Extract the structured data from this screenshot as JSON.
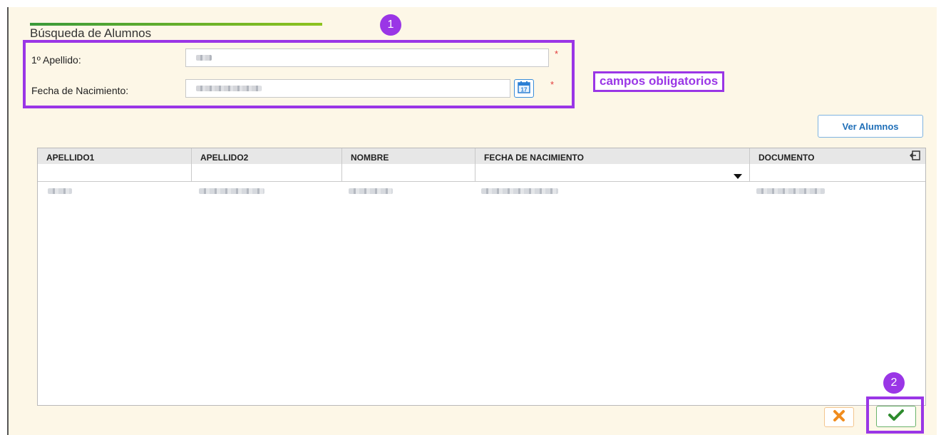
{
  "form": {
    "title": "Búsqueda de Alumnos",
    "apellido_label": "1º Apellido:",
    "fecha_label": "Fecha de Nacimiento:",
    "required_mark": "*"
  },
  "annotations": {
    "badge_1": "1",
    "badge_2": "2",
    "required_note": "campos obligatorios",
    "highlight_color": "#9a36e6"
  },
  "buttons": {
    "ver_alumnos": "Ver Alumnos"
  },
  "grid": {
    "columns": [
      "APELLIDO1",
      "APELLIDO2",
      "NOMBRE",
      "FECHA DE NACIMIENTO",
      "DOCUMENTO"
    ]
  },
  "icons": {
    "calendar": "calendar-icon",
    "filter_dropdown": "chevron-down-icon",
    "export": "export-icon",
    "cancel": "close-icon",
    "accept": "check-icon"
  },
  "colors": {
    "panel_bg": "#fdf7e7",
    "accent_blue": "#1f6fb8",
    "cancel_orange": "#f08c1e",
    "accept_green": "#2e8b2e"
  }
}
